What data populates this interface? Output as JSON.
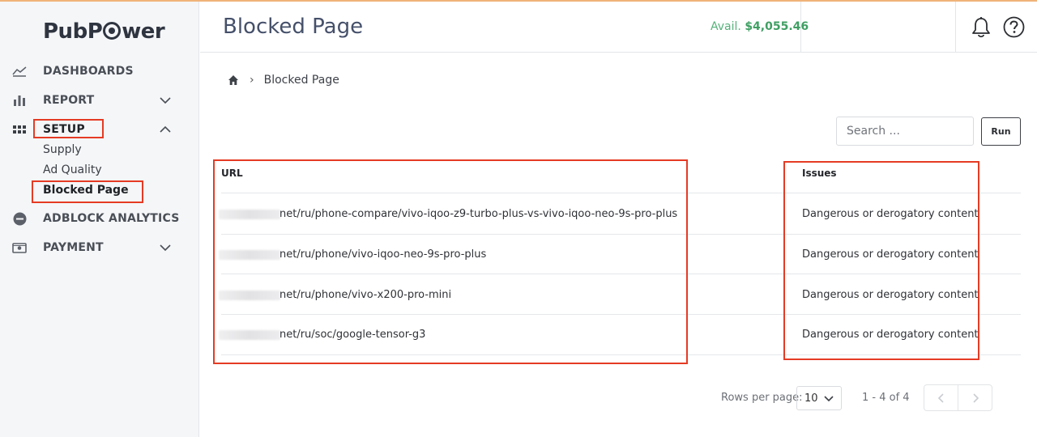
{
  "brand": {
    "logo_text_a": "Pub",
    "logo_text_b": "P",
    "logo_text_c": "wer"
  },
  "sidebar": {
    "items": [
      {
        "label": "DASHBOARDS",
        "icon": "line-chart-icon"
      },
      {
        "label": "REPORT",
        "icon": "bar-chart-icon",
        "expanded": false
      },
      {
        "label": "SETUP",
        "icon": "grid-icon",
        "expanded": true,
        "children": [
          {
            "label": "Supply"
          },
          {
            "label": "Ad Quality"
          },
          {
            "label": "Blocked Page",
            "active": true
          }
        ]
      },
      {
        "label": "ADBLOCK ANALYTICS",
        "icon": "minus-circle-icon"
      },
      {
        "label": "PAYMENT",
        "icon": "money-icon",
        "expanded": false
      }
    ]
  },
  "header": {
    "title": "Blocked Page",
    "avail_label": "Avail.",
    "avail_value": "$4,055.46",
    "icons": [
      "bell-icon",
      "help-icon"
    ]
  },
  "breadcrumb": {
    "home_icon": "home-icon",
    "separator": "›",
    "current": "Blocked Page"
  },
  "toolbar": {
    "search_placeholder": "Search ...",
    "run_label": "Run"
  },
  "table": {
    "columns": [
      "URL",
      "Issues"
    ],
    "rows": [
      {
        "url": "net/ru/phone-compare/vivo-iqoo-z9-turbo-plus-vs-vivo-iqoo-neo-9s-pro-plus",
        "issue": "Dangerous or derogatory content"
      },
      {
        "url": "net/ru/phone/vivo-iqoo-neo-9s-pro-plus",
        "issue": "Dangerous or derogatory content"
      },
      {
        "url": "net/ru/phone/vivo-x200-pro-mini",
        "issue": "Dangerous or derogatory content"
      },
      {
        "url": "net/ru/soc/google-tensor-g3",
        "issue": "Dangerous or derogatory content"
      }
    ]
  },
  "pagination": {
    "rows_per_page_label": "Rows per page:",
    "rows_per_page_value": "10",
    "range_text": "1 - 4 of 4"
  },
  "colors": {
    "accent_green": "#3f9f63",
    "highlight_red": "#e53b24",
    "title": "#45506a"
  }
}
